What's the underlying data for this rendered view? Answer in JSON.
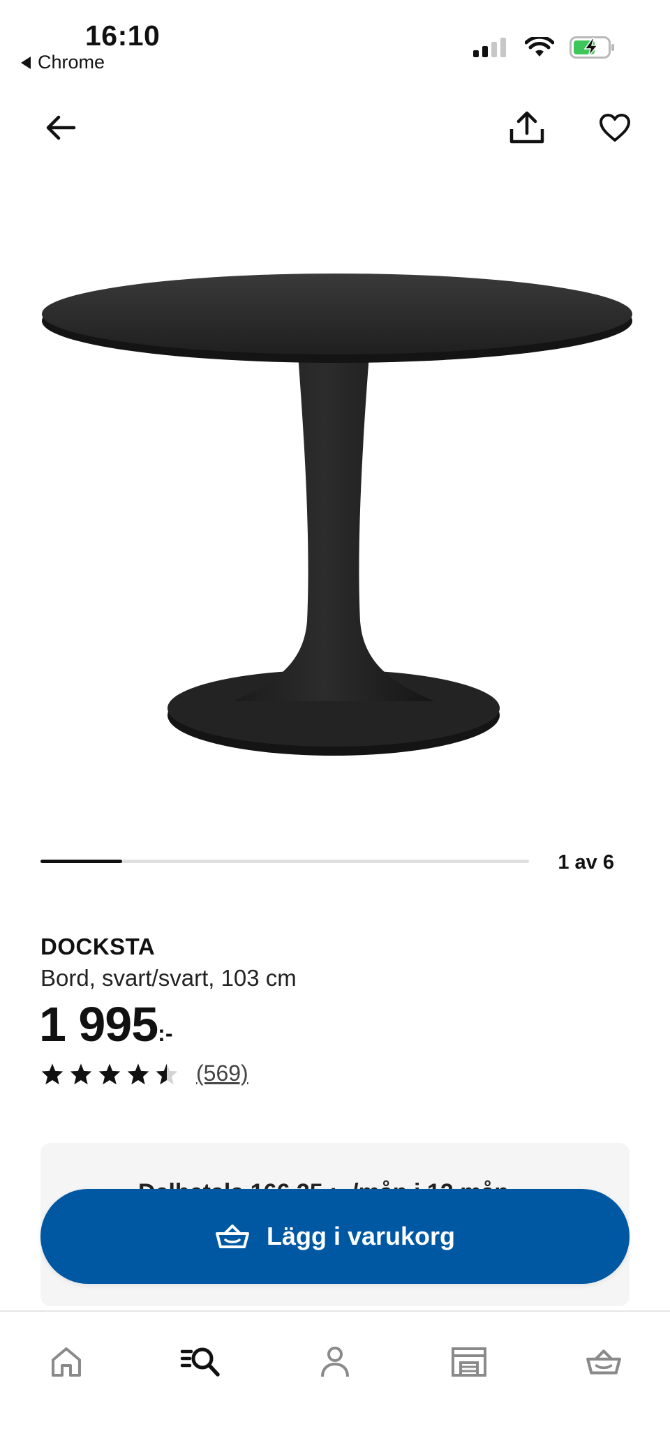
{
  "status_bar": {
    "time": "16:10",
    "back_app": "Chrome",
    "icons": [
      "signal-icon",
      "wifi-icon",
      "battery-charging-icon"
    ]
  },
  "nav": {
    "back_icon": "arrow-left-icon",
    "share_icon": "share-icon",
    "favorite_icon": "heart-icon"
  },
  "carousel": {
    "counter": "1 av 6",
    "progress_fraction": 0.1667
  },
  "product": {
    "name": "DOCKSTA",
    "description": "Bord, svart/svart, 103 cm",
    "price": "1 995",
    "price_suffix": ":-",
    "rating": 4.5,
    "rating_max": 5,
    "review_count": "(569)"
  },
  "info_box": {
    "text": "Delbetala 166,25 :- /mån i 12 mån"
  },
  "cta": {
    "label": "Lägg i varukorg",
    "icon": "basket-icon",
    "color": "#0058a3"
  },
  "tabbar": {
    "items": [
      "home-icon",
      "search-list-icon",
      "profile-icon",
      "store-icon",
      "basket-icon"
    ],
    "active": "search-list-icon"
  }
}
